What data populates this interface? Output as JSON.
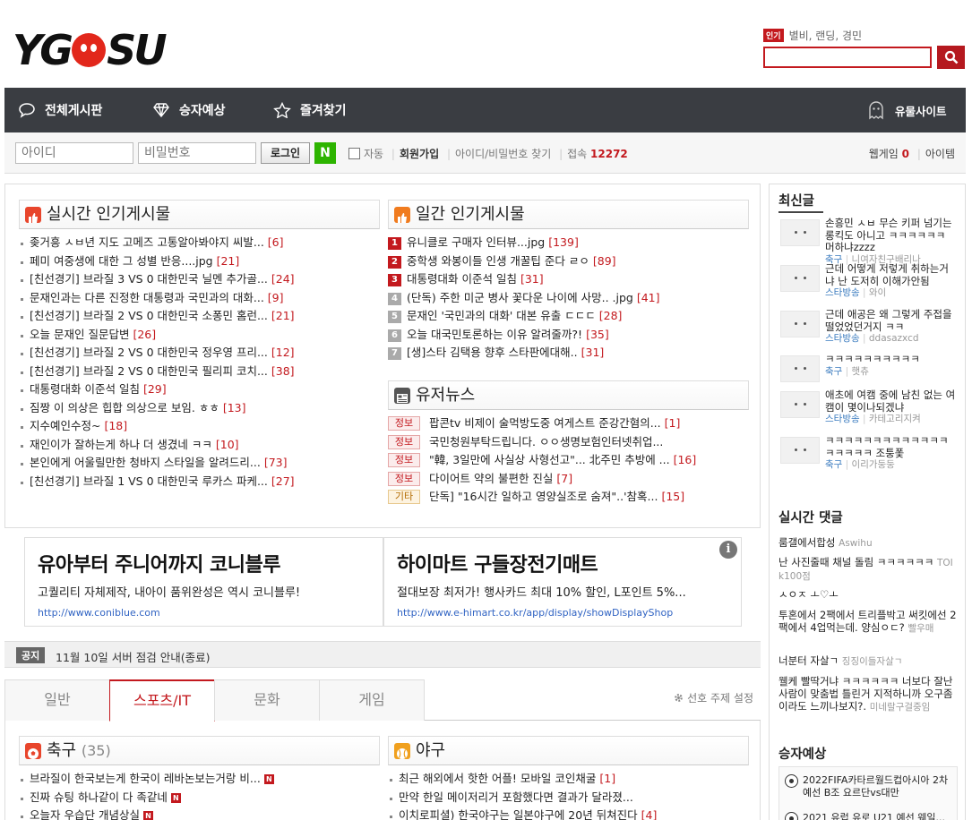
{
  "header": {
    "logo_text": "YGOSU",
    "popular_badge": "인기",
    "popular_keywords": "별비, 랜딩, 경민",
    "search_placeholder": ""
  },
  "nav": {
    "board": "전체게시판",
    "predict": "승자예상",
    "favorites": "즐겨찾기",
    "ghost_site": "유물사이트"
  },
  "login": {
    "id_placeholder": "아이디",
    "pw_placeholder": "비밀번호",
    "login_label": "로그인",
    "naver_label": "N",
    "auto_label": "자동",
    "signup": "회원가입",
    "find": "아이디/비밀번호 찾기",
    "online_label": "접속",
    "online_count": "12272",
    "webgame_label": "웹게임",
    "webgame_count": "0",
    "item_label": "아이템"
  },
  "realtime": {
    "title": "실시간 인기게시물",
    "items": [
      {
        "title": "좆거흥 ㅅㅂ년 지도 고메즈 고통알아봐야지 씨발...",
        "count": "[6]"
      },
      {
        "title": "페미 여중생에 대한 그 성별 반응....jpg",
        "count": "[21]"
      },
      {
        "title": "[친선경기] 브라질 3 VS 0 대한민국 닐멘 추가골...",
        "count": "[24]"
      },
      {
        "title": "문재인과는 다른 진정한 대통령과 국민과의 대화...",
        "count": "[9]"
      },
      {
        "title": "[친선경기] 브라질 2 VS 0 대한민국 소퐁민 홈런...",
        "count": "[21]"
      },
      {
        "title": "오늘 문재인 질문답변",
        "count": "[26]"
      },
      {
        "title": "[친선경기] 브라질 2 VS 0 대한민국 정우영 프리...",
        "count": "[12]"
      },
      {
        "title": "[친선경기] 브라질 2 VS 0 대한민국 필리피 코치...",
        "count": "[38]"
      },
      {
        "title": "대통령대화 이준석 일침",
        "count": "[29]"
      },
      {
        "title": "짐짱 이 의상은 힙합 의상으로 보임. ㅎㅎ",
        "count": "[13]"
      },
      {
        "title": "지수예인수정~",
        "count": "[18]"
      },
      {
        "title": "재인이가 잘하는게 하나 더 생겼네 ㅋㅋ",
        "count": "[10]"
      },
      {
        "title": "본인에게 어울릴만한 청바지 스타일을 알려드리...",
        "count": "[73]"
      },
      {
        "title": "[친선경기] 브라질 1 VS 0 대한민국 루카스 파케...",
        "count": "[27]"
      }
    ]
  },
  "daily": {
    "title": "일간 인기게시물",
    "items": [
      {
        "rank": "1",
        "title": "유니클로 구매자 인터뷰...jpg",
        "count": "[139]"
      },
      {
        "rank": "2",
        "title": "중학생 와봉이들 인생 개꿀팁 준다 ㄹㅇ",
        "count": "[89]"
      },
      {
        "rank": "3",
        "title": "대통령대화 이준석 일침",
        "count": "[31]"
      },
      {
        "rank": "4",
        "title": "(단독) 주한 미군 병사 꽃다운 나이에 사망.. .jpg",
        "count": "[41]"
      },
      {
        "rank": "5",
        "title": "문재인 '국민과의 대화' 대본 유출 ㄷㄷㄷ",
        "count": "[28]"
      },
      {
        "rank": "6",
        "title": "오늘 대국민토론하는 이유 알려줄까?!",
        "count": "[35]"
      },
      {
        "rank": "7",
        "title": "[생]스타 김택용 향후 스타판에대해..",
        "count": "[31]"
      }
    ],
    "rank_colors": [
      "#c3191e",
      "#c3191e",
      "#c3191e",
      "#aaaaaa",
      "#aaaaaa",
      "#aaaaaa",
      "#aaaaaa"
    ]
  },
  "news": {
    "title": "유저뉴스",
    "items": [
      {
        "tag": "정보",
        "title": "팝콘tv 비제이 술먹방도중 여게스트 준강간혐의...",
        "count": "[1]"
      },
      {
        "tag": "정보",
        "title": "국민청원부탁드립니다. ㅇㅇ생명보험인터넷취업...",
        "count": ""
      },
      {
        "tag": "정보",
        "title": "\"韓, 3일만에 사실상 사형선고\"... 北주민 추방에 ...",
        "count": "[16]"
      },
      {
        "tag": "정보",
        "title": "다이어트 약의 불편한 진실",
        "count": "[7]"
      },
      {
        "tag": "기타",
        "title": "단독] \"16시간 일하고 영양실조로 숨져\"..'참혹...",
        "count": "[15]"
      }
    ]
  },
  "ads": [
    {
      "title": "유아부터 주니어까지 코니블루",
      "desc": "고퀄리티 자체제작, 내아이 품위완성은 역시 코니블루!",
      "url": "http://www.coniblue.com"
    },
    {
      "title": "하이마트 구들장전기매트",
      "desc": "절대보장 최저가! 행사카드 최대 10% 할인, L포인트 5%...",
      "url": "http://www.e-himart.co.kr/app/display/showDisplayShop"
    }
  ],
  "ad_info_label": "i",
  "notice": {
    "badge": "공지",
    "text": "11월 10일 서버 점검 안내(종료)"
  },
  "tabs": [
    "일반",
    "스포츠/IT",
    "문화",
    "게임"
  ],
  "pref_label": "선호 주제 설정",
  "soccer": {
    "title": "축구",
    "count": "(35)",
    "items": [
      "브라질이 한국보는게 한국이 레바논보는거랑 비...",
      "진짜 슈팅 하나같이 다 족같네",
      "오늘자 우습단 개념상실"
    ]
  },
  "baseball": {
    "title": "야구",
    "items": [
      {
        "title": "최근 해외에서 핫한 어플! 모바일 코인채굴",
        "count": "[1]"
      },
      {
        "title": "만약 한일 메이저리거 포함했다면 결과가 달라졌...",
        "count": ""
      },
      {
        "title": "이치로피셜) 한국야구는 일본야구에 20년 뒤쳐진다",
        "count": "[4]"
      }
    ]
  },
  "sidebar": {
    "recent_title": "최신글",
    "recent": [
      {
        "text": "손흥민 ㅅㅂ 무슨 키퍼 넘기는 롱킥도 아니고 ㅋㅋㅋㅋㅋㅋ 머하냐zzzz",
        "board": "축구",
        "author": "니여자친구배리나"
      },
      {
        "text": "근데 어떻게 저렇게 취하는거냐 난 도저히 이해가안됨",
        "board": "스타방송",
        "author": "와이"
      },
      {
        "text": "근데 애공은 왜 그렇게 주접을 떨었었던거지 ㅋㅋ",
        "board": "스타방송",
        "author": "ddasazxcd"
      },
      {
        "text": "ㅋㅋㅋㅋㅋㅋㅋㅋㅋㅋ",
        "board": "축구",
        "author": "햇츄"
      },
      {
        "text": "애초에 여캠 중에 남친 없는 여캠이 몇이나되겠냐",
        "board": "스타방송",
        "author": "카테고리지켜"
      },
      {
        "text": "ㅋㅋㅋㅋㅋㅋㅋㅋㅋㅋㅋㅋㅋㅋㅋㅋㅋㅋ 조퉁퐃",
        "board": "축구",
        "author": "이리가둥둥"
      }
    ],
    "comments_title": "실시간 댓글",
    "comments": [
      {
        "text": "룸갤에서합성",
        "author": "Aswihu"
      },
      {
        "text": "난 사진줄때 채널 돌림 ㅋㅋㅋㅋㅋㅋ",
        "author": "TOIk100점"
      },
      {
        "text": "ㅅㅇㅈ ㅗ♡ㅗ",
        "author": ""
      },
      {
        "text": "투혼에서 2팩에서 트리플박고 써킷에선 2팩에서 4업먹는데. 양심ㅇㄷ?",
        "author": "빨우매"
      },
      {
        "text": "너분터 자살ㄱ",
        "author": "징징이들자살ㄱ"
      },
      {
        "text": "웰케 빨딱거냐 ㅋㅋㅋㅋㅋㅋ 너보다 잘난사람이 맞춤법 틀린거 지적하니까 오구좀이라도 느끼나보지?.",
        "author": "미네랄구걸중임"
      }
    ],
    "predict_title": "승자예상",
    "predict": [
      {
        "text": "2022FIFA카타르월드컵아시아 2차예선 B조 요르단vs대만"
      },
      {
        "text": "2021 유럽 유로 U21 예선 웨일..."
      }
    ]
  }
}
